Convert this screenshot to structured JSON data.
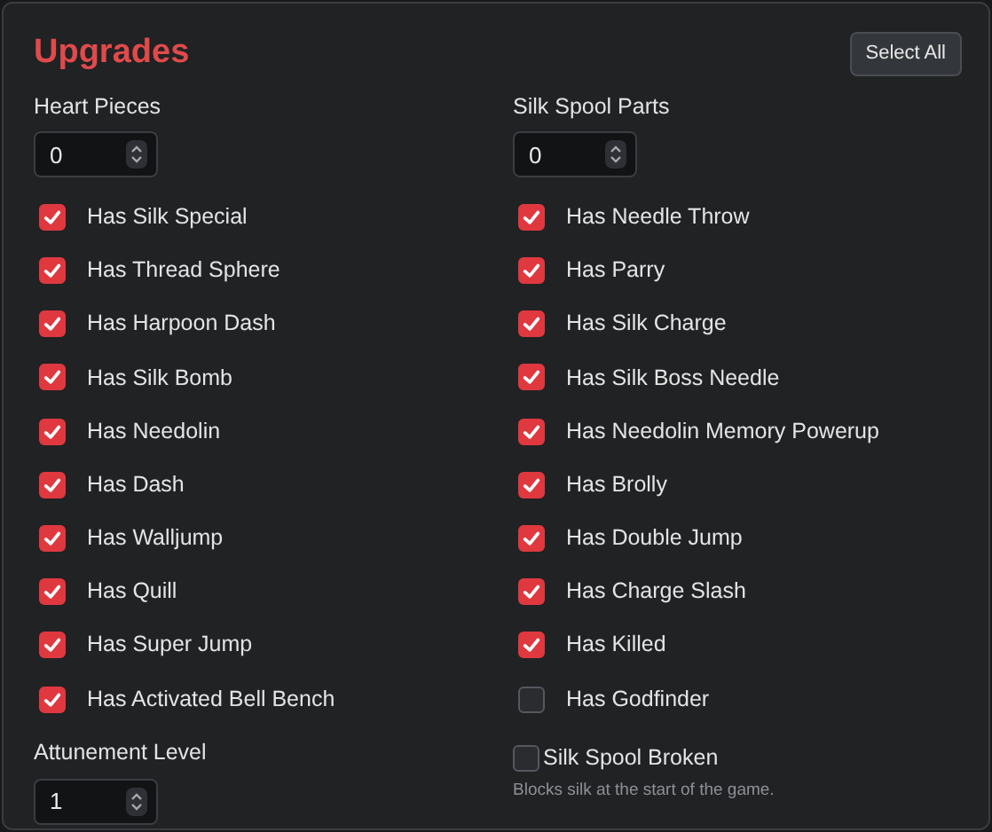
{
  "title": "Upgrades",
  "select_all": "Select All",
  "counters": [
    {
      "label": "Heart Pieces",
      "value": "0"
    },
    {
      "label": "Silk Spool Parts",
      "value": "0"
    }
  ],
  "left": [
    {
      "label": "Has Silk Special",
      "checked": true
    },
    {
      "label": "Has Thread Sphere",
      "checked": true
    },
    {
      "label": "Has Harpoon Dash",
      "checked": true
    },
    {
      "label": "Has Silk Bomb",
      "checked": true
    },
    {
      "label": "Has Needolin",
      "checked": true
    },
    {
      "label": "Has Dash",
      "checked": true
    },
    {
      "label": "Has Walljump",
      "checked": true
    },
    {
      "label": "Has Quill",
      "checked": true
    },
    {
      "label": "Has Super Jump",
      "checked": true
    },
    {
      "label": "Has Activated Bell Bench",
      "checked": true
    }
  ],
  "right": [
    {
      "label": "Has Needle Throw",
      "checked": true
    },
    {
      "label": "Has Parry",
      "checked": true
    },
    {
      "label": "Has Silk Charge",
      "checked": true
    },
    {
      "label": "Has Silk Boss Needle",
      "checked": true
    },
    {
      "label": "Has Needolin Memory Powerup",
      "checked": true
    },
    {
      "label": "Has Brolly",
      "checked": true
    },
    {
      "label": "Has Double Jump",
      "checked": true
    },
    {
      "label": "Has Charge Slash",
      "checked": true
    },
    {
      "label": "Has Killed",
      "checked": true
    },
    {
      "label": "Has Godfinder",
      "checked": false
    }
  ],
  "attunement": {
    "label": "Attunement Level",
    "value": "1"
  },
  "silk_spool_broken": {
    "label": "Silk Spool Broken",
    "checked": false,
    "hint": "Blocks silk at the start of the game."
  }
}
